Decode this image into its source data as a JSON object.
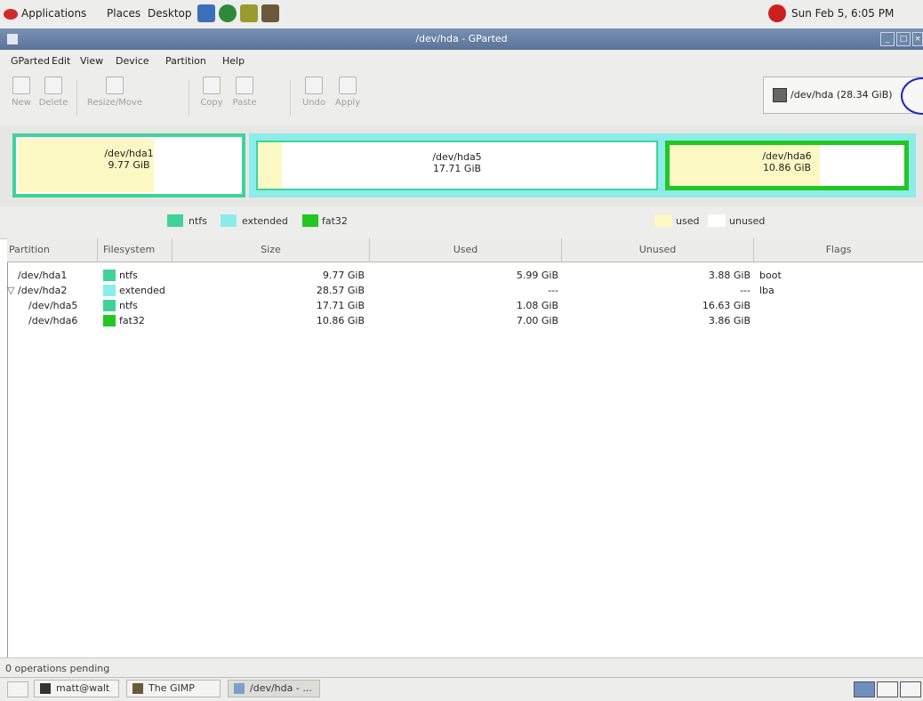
{
  "top_panel": {
    "menus": [
      "Applications",
      "Places",
      "Desktop"
    ],
    "clock": "Sun Feb  5,  6:05 PM"
  },
  "window": {
    "title": "/dev/hda - GParted"
  },
  "menubar": [
    "GParted",
    "Edit",
    "View",
    "Device",
    "Partition",
    "Help"
  ],
  "toolbar": {
    "buttons": [
      "New",
      "Delete",
      "Resize/Move",
      "Copy",
      "Paste",
      "Undo",
      "Apply"
    ]
  },
  "device_selector": {
    "label": "/dev/hda   (28.34 GiB)"
  },
  "graphic": {
    "partitions": [
      {
        "name": "/dev/hda1",
        "size": "9.77 GiB",
        "used_fraction": 0.61
      },
      {
        "name": "/dev/hda5",
        "size": "17.71 GiB",
        "used_fraction": 0.06
      },
      {
        "name": "/dev/hda6",
        "size": "10.86 GiB",
        "used_fraction": 0.64
      }
    ]
  },
  "legend": {
    "fs": [
      "ntfs",
      "extended",
      "fat32"
    ],
    "usage": [
      "used",
      "unused"
    ]
  },
  "colors": {
    "ntfs": "#3fd39a",
    "extended": "#8cecea",
    "fat32": "#22c722",
    "used": "#fbf8c4",
    "unused": "#ffffff"
  },
  "table": {
    "headers": [
      "Partition",
      "Filesystem",
      "Size",
      "Used",
      "Unused",
      "Flags"
    ],
    "rows": [
      {
        "partition": "/dev/hda1",
        "filesystem": "ntfs",
        "size": "9.77 GiB",
        "used": "5.99 GiB",
        "unused": "3.88 GiB",
        "flags": "boot"
      },
      {
        "partition": "/dev/hda2",
        "filesystem": "extended",
        "size": "28.57 GiB",
        "used": "---",
        "unused": "---",
        "flags": "lba"
      },
      {
        "partition": "/dev/hda5",
        "filesystem": "ntfs",
        "size": "17.71 GiB",
        "used": "1.08 GiB",
        "unused": "16.63 GiB",
        "flags": ""
      },
      {
        "partition": "/dev/hda6",
        "filesystem": "fat32",
        "size": "10.86 GiB",
        "used": "7.00 GiB",
        "unused": "3.86 GiB",
        "flags": ""
      }
    ]
  },
  "status": "0 operations pending",
  "taskbar": [
    "matt@walt",
    "The GIMP",
    "/dev/hda - ..."
  ]
}
